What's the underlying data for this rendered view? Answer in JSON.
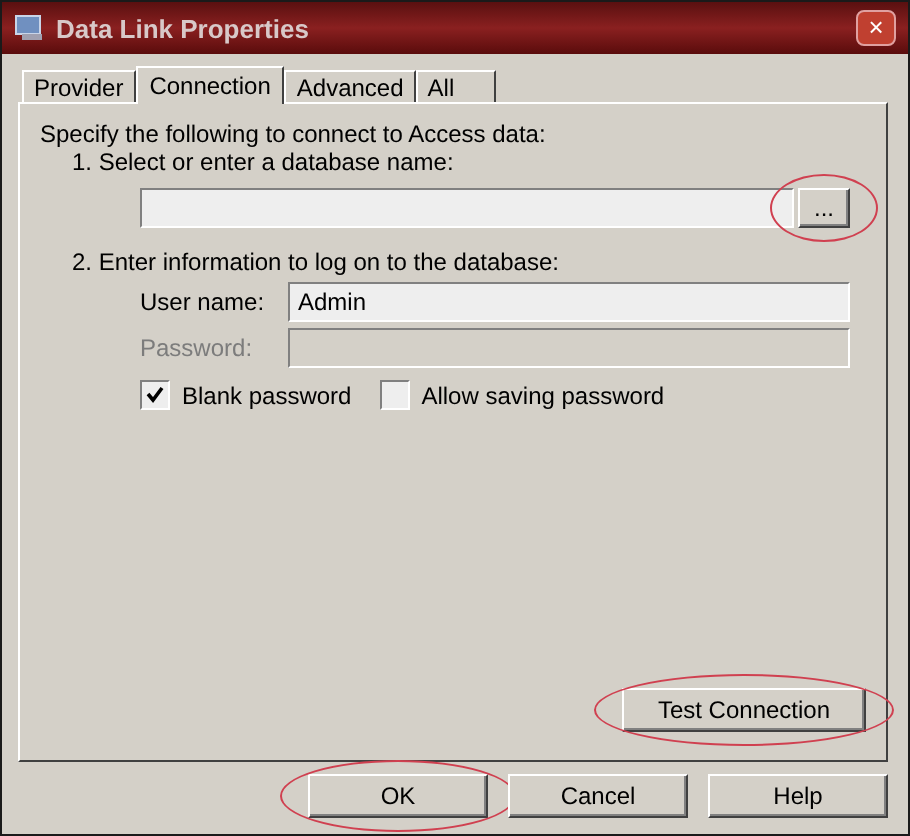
{
  "window": {
    "title": "Data Link Properties",
    "close": "×"
  },
  "tabs": [
    {
      "label": "Provider",
      "selected": false
    },
    {
      "label": "Connection",
      "selected": true
    },
    {
      "label": "Advanced",
      "selected": false
    },
    {
      "label": "All",
      "selected": false
    }
  ],
  "intro": "Specify the following to connect to Access data:",
  "step_1": "1. Select or enter a database name:",
  "database_field": {
    "browse": {
      "label": "...",
      "highlighted": true
    }
  },
  "step_2": "2. Enter information to log on to the database:",
  "fields": [
    {
      "label": "User name:",
      "value": "Admin",
      "disabled": false
    },
    {
      "label": "Password:",
      "disabled": true
    }
  ],
  "checkboxes": [
    {
      "label": "Blank password",
      "checked": true
    },
    {
      "label": "Allow saving password",
      "checked": false
    }
  ],
  "test_button": {
    "label": "Test Connection",
    "highlighted": true
  },
  "buttons": [
    {
      "label": "OK",
      "highlighted": true
    },
    {
      "label": "Cancel",
      "highlighted": false
    },
    {
      "label": "Help",
      "highlighted": false
    }
  ]
}
